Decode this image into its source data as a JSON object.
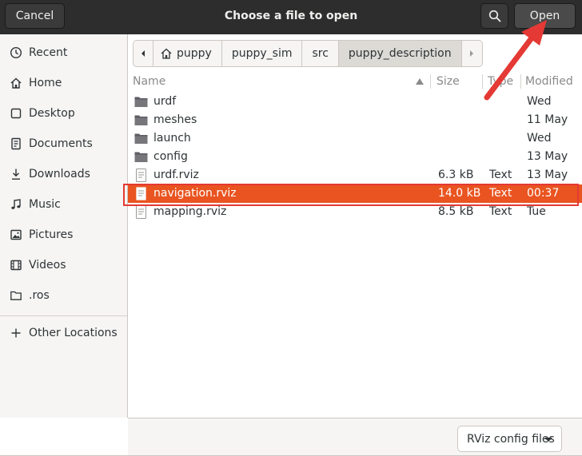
{
  "header": {
    "cancel_label": "Cancel",
    "title": "Choose a file to open",
    "open_label": "Open",
    "search_icon": "search-icon"
  },
  "sidebar": {
    "items": [
      {
        "label": "Recent",
        "icon": "clock-icon"
      },
      {
        "label": "Home",
        "icon": "home-icon"
      },
      {
        "label": "Desktop",
        "icon": "desktop-icon"
      },
      {
        "label": "Documents",
        "icon": "documents-icon"
      },
      {
        "label": "Downloads",
        "icon": "downloads-icon"
      },
      {
        "label": "Music",
        "icon": "music-icon"
      },
      {
        "label": "Pictures",
        "icon": "pictures-icon"
      },
      {
        "label": "Videos",
        "icon": "videos-icon"
      },
      {
        "label": ".ros",
        "icon": "folder-icon"
      },
      {
        "label": "Other Locations",
        "icon": "plus-icon"
      }
    ]
  },
  "pathbar": {
    "segments": [
      "puppy",
      "puppy_sim",
      "src",
      "puppy_description"
    ],
    "active_segment": "puppy_description"
  },
  "columns": {
    "name": "Name",
    "size": "Size",
    "type": "Type",
    "modified": "Modified"
  },
  "files": [
    {
      "name": "urdf",
      "size": "",
      "type": "",
      "modified": "Wed",
      "kind": "folder"
    },
    {
      "name": "meshes",
      "size": "",
      "type": "",
      "modified": "11 May",
      "kind": "folder"
    },
    {
      "name": "launch",
      "size": "",
      "type": "",
      "modified": "Wed",
      "kind": "folder"
    },
    {
      "name": "config",
      "size": "",
      "type": "",
      "modified": "13 May",
      "kind": "folder"
    },
    {
      "name": "urdf.rviz",
      "size": "6.3 kB",
      "type": "Text",
      "modified": "13 May",
      "kind": "file"
    },
    {
      "name": "navigation.rviz",
      "size": "14.0 kB",
      "type": "Text",
      "modified": "00:37",
      "kind": "file",
      "selected": true
    },
    {
      "name": "mapping.rviz",
      "size": "8.5 kB",
      "type": "Text",
      "modified": "Tue",
      "kind": "file"
    }
  ],
  "footer": {
    "filter_label": "RViz config files"
  },
  "colors": {
    "accent": "#e95420",
    "annotation": "#e53935",
    "headerbar": "#2d2d2d"
  }
}
